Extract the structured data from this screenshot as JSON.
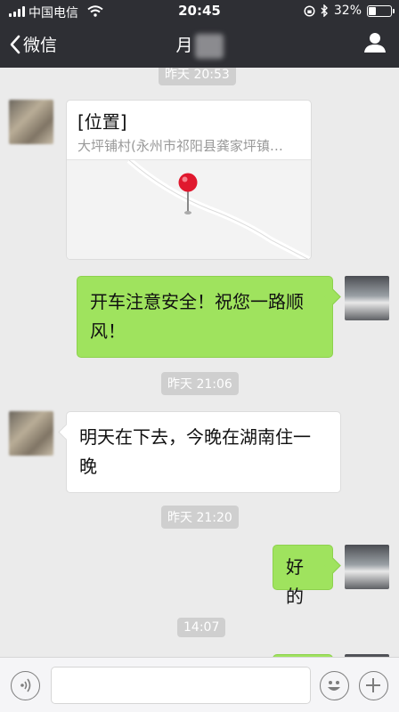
{
  "status": {
    "carrier": "中国电信",
    "time": "20:45",
    "battery_percent": "32%",
    "battery_level": 0.32
  },
  "nav": {
    "back_label": "微信",
    "title": "月"
  },
  "chat": {
    "items": [
      {
        "type": "time",
        "text": "昨天 20:53"
      },
      {
        "type": "location",
        "side": "left",
        "title": "[位置]",
        "address": "大坪铺村(永州市祁阳县龚家坪镇…"
      },
      {
        "type": "text",
        "side": "right",
        "text_line1": "开车注意安全！祝您一路顺",
        "text_line2": "风！"
      },
      {
        "type": "time",
        "text": "昨天 21:06"
      },
      {
        "type": "text",
        "side": "left",
        "text_line1": "明天在下去，今晚在湖南住一",
        "text_line2": "晚"
      },
      {
        "type": "time",
        "text": "昨天 21:20"
      },
      {
        "type": "text",
        "side": "right",
        "text_line1": "好的"
      },
      {
        "type": "time",
        "text": "14:07"
      }
    ]
  },
  "input": {
    "value": "",
    "placeholder": ""
  }
}
